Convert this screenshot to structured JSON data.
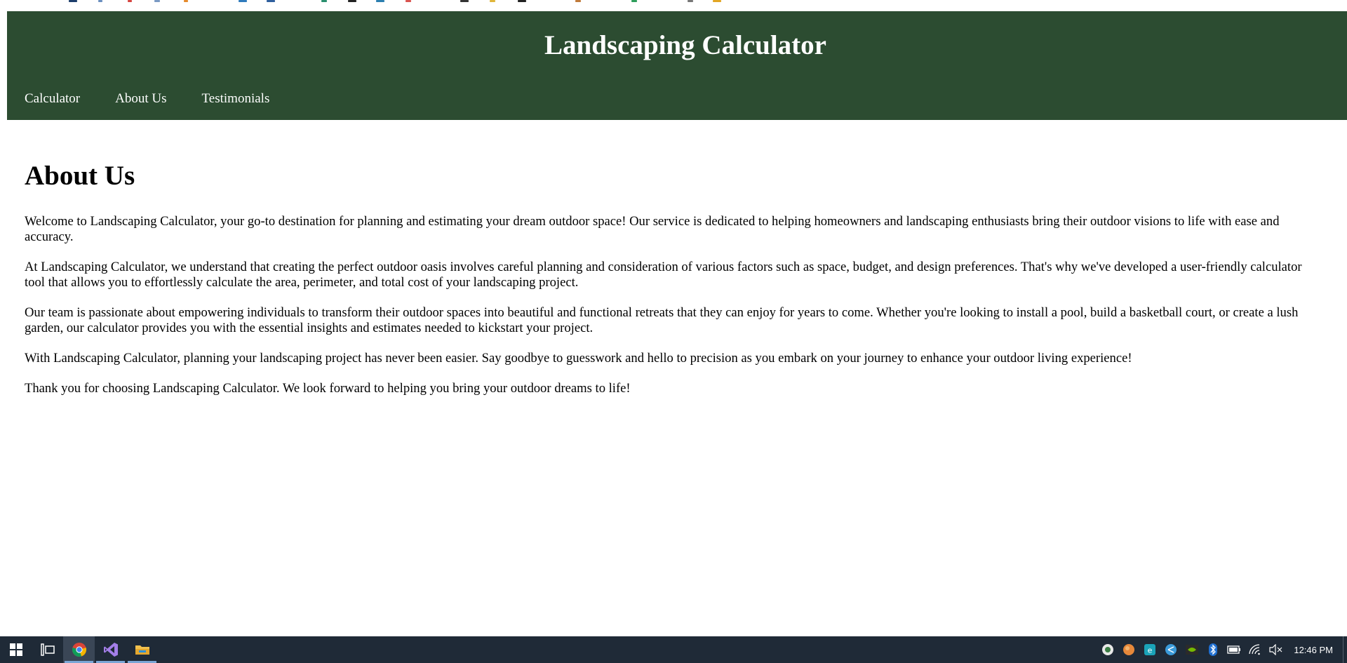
{
  "site": {
    "title": "Landscaping Calculator",
    "header_color": "#2c4c31"
  },
  "nav": {
    "items": [
      {
        "label": "Calculator"
      },
      {
        "label": "About Us"
      },
      {
        "label": "Testimonials"
      }
    ]
  },
  "about": {
    "heading": "About Us",
    "paragraphs": [
      "Welcome to Landscaping Calculator, your go-to destination for planning and estimating your dream outdoor space! Our service is dedicated to helping homeowners and landscaping enthusiasts bring their outdoor visions to life with ease and accuracy.",
      "At Landscaping Calculator, we understand that creating the perfect outdoor oasis involves careful planning and consideration of various factors such as space, budget, and design preferences. That's why we've developed a user-friendly calculator tool that allows you to effortlessly calculate the area, perimeter, and total cost of your landscaping project.",
      "Our team is passionate about empowering individuals to transform their outdoor spaces into beautiful and functional retreats that they can enjoy for years to come. Whether you're looking to install a pool, build a basketball court, or create a lush garden, our calculator provides you with the essential insights and estimates needed to kickstart your project.",
      "With Landscaping Calculator, planning your landscaping project has never been easier. Say goodbye to guesswork and hello to precision as you embark on your journey to enhance your outdoor living experience!",
      "Thank you for choosing Landscaping Calculator. We look forward to helping you bring your outdoor dreams to life!"
    ]
  },
  "taskbar": {
    "apps": [
      {
        "icon": "windows-start-icon"
      },
      {
        "icon": "task-view-icon"
      },
      {
        "icon": "chrome-icon",
        "active": true
      },
      {
        "icon": "visual-studio-icon",
        "running": true
      },
      {
        "icon": "file-explorer-icon",
        "running": true
      }
    ],
    "tray_icons": [
      "tray-app-icon",
      "tray-orange-icon",
      "tray-teal-icon",
      "tray-share-icon",
      "nvidia-icon",
      "bluetooth-icon",
      "battery-icon",
      "wifi-icon",
      "speaker-muted-icon"
    ],
    "clock": "12:46 PM"
  }
}
